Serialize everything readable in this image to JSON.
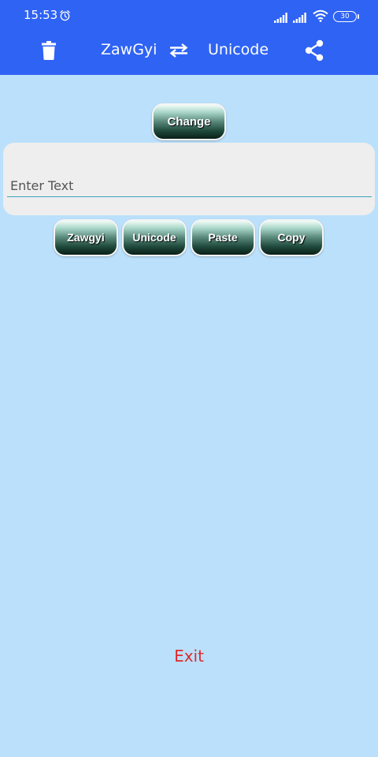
{
  "status_bar": {
    "time": "15:53",
    "battery": "30"
  },
  "app_bar": {
    "left_label": "ZawGyi",
    "right_label": "Unicode",
    "icons": [
      "trash-icon",
      "swap-icon",
      "share-icon"
    ]
  },
  "main": {
    "change_label": "Change",
    "input_placeholder": "Enter Text",
    "input_value": "",
    "actions": [
      {
        "label": "Zawgyi"
      },
      {
        "label": "Unicode"
      },
      {
        "label": "Paste"
      },
      {
        "label": "Copy"
      }
    ],
    "exit_label": "Exit"
  },
  "colors": {
    "app_bar": "#2f63f4",
    "background": "#bbe0fb",
    "input_card": "#eeeeee",
    "input_underline": "#3aa3b8",
    "exit_text": "#dd2b2b"
  }
}
